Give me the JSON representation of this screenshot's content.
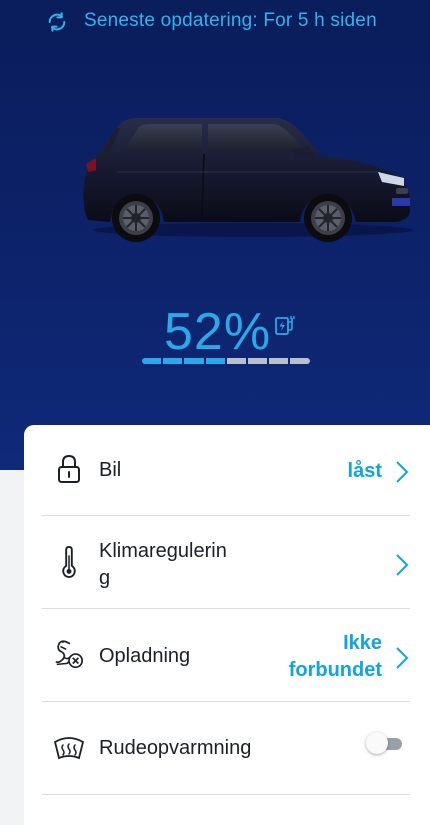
{
  "status": {
    "icon": "refresh-icon",
    "text": "Seneste opdatering: For 5 h siden"
  },
  "vehicle": {
    "image": "car-image",
    "battery": {
      "percent_label": "52%",
      "percent": 52,
      "segments_total": 8,
      "segments_filled": 4,
      "charge_icon": "charging-plug-icon"
    }
  },
  "rows": [
    {
      "icon": "lock-icon",
      "label": "Bil",
      "value": "låst",
      "chevron": "chevron-right-icon"
    },
    {
      "icon": "thermometer-icon",
      "label_line1": "Klimaregulerin",
      "label_line2": "g",
      "chevron": "chevron-right-icon"
    },
    {
      "icon": "charging-cable-disconnected-icon",
      "label": "Opladning",
      "value_line1": "Ikke",
      "value_line2": "forbundet",
      "chevron": "chevron-right-icon"
    },
    {
      "icon": "window-heating-icon",
      "label": "Rudeopvarmning",
      "toggle_on": false
    }
  ],
  "colors": {
    "accent": "#0fa4e6",
    "hero_bg": "#0c2167",
    "battery_fill": "#29a9ea"
  }
}
